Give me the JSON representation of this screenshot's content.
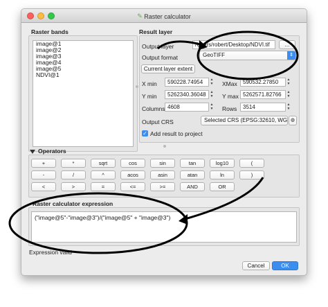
{
  "window": {
    "title": "Raster calculator"
  },
  "raster_bands": {
    "title": "Raster bands",
    "items": [
      "image@1",
      "image@2",
      "image@3",
      "image@4",
      "image@5",
      "NDVI@1"
    ]
  },
  "result_layer": {
    "title": "Result layer",
    "output_layer_label": "Output layer",
    "output_layer_value": "/Users/robert/Desktop/NDVI.tif",
    "browse_label": "...",
    "output_format_label": "Output format",
    "output_format_value": "GeoTIFF",
    "current_extent_label": "Current layer extent",
    "xmin_label": "X min",
    "xmin_value": "590228.74954",
    "xmax_label": "XMax",
    "xmax_value": "590532.27850",
    "ymin_label": "Y min",
    "ymin_value": "5262340.36048",
    "ymax_label": "Y max",
    "ymax_value": "5262571.82766",
    "columns_label": "Columns",
    "columns_value": "4608",
    "rows_label": "Rows",
    "rows_value": "3514",
    "crs_label": "Output CRS",
    "crs_value": "Selected CRS (EPSG:32610, WG",
    "add_result_label": "Add result to project"
  },
  "operators": {
    "title": "Operators",
    "buttons": [
      "+",
      "*",
      "sqrt",
      "cos",
      "sin",
      "tan",
      "log10",
      "(",
      "-",
      "/",
      "^",
      "acos",
      "asin",
      "atan",
      "ln",
      ")",
      "<",
      ">",
      "=",
      "<=",
      ">=",
      "AND",
      "OR"
    ]
  },
  "expression": {
    "title": "Raster calculator expression",
    "value": "(\"image@5\"-\"image@3\")/(\"image@5\" + \"image@3\")",
    "status": "Expression valid"
  },
  "footer": {
    "cancel_label": "Cancel",
    "ok_label": "OK"
  },
  "colors": {
    "accent": "#3b8ef0",
    "annotation": "#000000"
  }
}
